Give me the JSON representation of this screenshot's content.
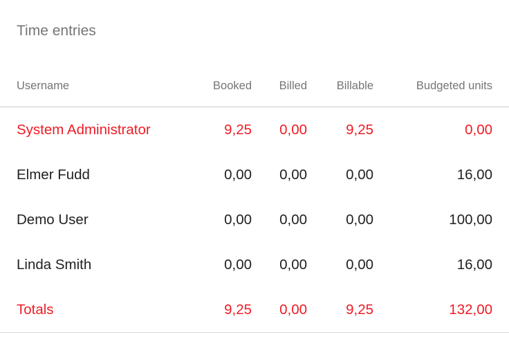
{
  "panel": {
    "title": "Time entries"
  },
  "table": {
    "headers": {
      "username": "Username",
      "booked": "Booked",
      "billed": "Billed",
      "billable": "Billable",
      "budgeted": "Budgeted units"
    },
    "rows": [
      {
        "username": "System Administrator",
        "booked": "9,25",
        "billed": "0,00",
        "billable": "9,25",
        "budgeted": "0,00",
        "highlight": true
      },
      {
        "username": "Elmer Fudd",
        "booked": "0,00",
        "billed": "0,00",
        "billable": "0,00",
        "budgeted": "16,00",
        "highlight": false
      },
      {
        "username": "Demo User",
        "booked": "0,00",
        "billed": "0,00",
        "billable": "0,00",
        "budgeted": "100,00",
        "highlight": false
      },
      {
        "username": "Linda Smith",
        "booked": "0,00",
        "billed": "0,00",
        "billable": "0,00",
        "budgeted": "16,00",
        "highlight": false
      }
    ],
    "totals": {
      "label": "Totals",
      "booked": "9,25",
      "billed": "0,00",
      "billable": "9,25",
      "budgeted": "132,00"
    }
  },
  "colors": {
    "highlight": "#ee1c25",
    "muted_text": "#757575",
    "text": "#212121",
    "divider": "#c8c8c8"
  }
}
